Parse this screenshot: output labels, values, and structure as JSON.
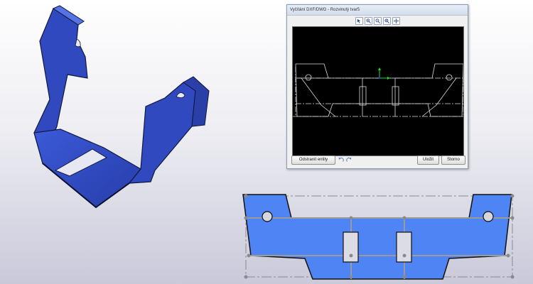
{
  "dialog": {
    "title": "Vyčítání DXF/DWG - Rozvinutý tvar5",
    "toolbar": [
      {
        "name": "select-tool",
        "icon": "select-arrow-icon"
      },
      {
        "name": "zoom-in-tool",
        "icon": "zoom-in-icon"
      },
      {
        "name": "zoom-out-tool",
        "icon": "zoom-out-icon"
      },
      {
        "name": "zoom-fit-tool",
        "icon": "zoom-fit-icon"
      },
      {
        "name": "pan-tool",
        "icon": "pan-icon"
      }
    ],
    "buttons": {
      "remove_entities": "Odstranit entity",
      "save": "Uložit",
      "cancel": "Storno"
    },
    "history": {
      "undo_icon": "undo-icon",
      "redo_icon": "redo-icon"
    }
  },
  "colors": {
    "part_blue": "#4f79ea",
    "part_dark": "#2d3fb5",
    "viewport_bg": "#000000",
    "line_color": "#dddddd",
    "axis_green": "#22dd22",
    "axis_blue": "#2244ff"
  }
}
